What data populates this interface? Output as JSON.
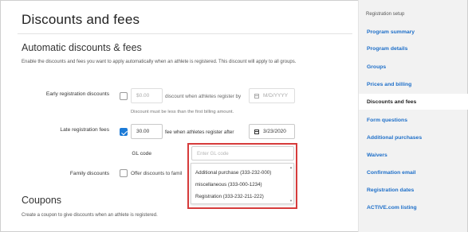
{
  "page": {
    "title": "Discounts and fees"
  },
  "automatic": {
    "title": "Automatic discounts & fees",
    "description": "Enable the discounts and fees you want to apply automatically when an athlete is registered. This discount will apply to all groups."
  },
  "early": {
    "label": "Early registration discounts",
    "checked": false,
    "amount": "$0.00",
    "mid_text": "discount when athletes register by",
    "date_placeholder": "M/D/YYYY",
    "note": "Discount must be less than the first billing amount."
  },
  "late": {
    "label": "Late registration fees",
    "checked": true,
    "amount": "30.00",
    "mid_text": "fee when athletes register after",
    "date": "3/23/2020"
  },
  "gl": {
    "label": "GL code",
    "placeholder": "Enter GL code",
    "options": [
      "Additional purchase (333-232-000)",
      "miscellaneous (333-000-1234)",
      "Registration (333-232-211-222)"
    ]
  },
  "family": {
    "label": "Family discounts",
    "checked": false,
    "text": "Offer discounts to famil"
  },
  "coupons": {
    "title": "Coupons",
    "description": "Create a coupon to give discounts when an athlete is registered."
  },
  "sidebar": {
    "heading": "Registration setup",
    "items": [
      {
        "label": "Program summary",
        "active": false
      },
      {
        "label": "Program details",
        "active": false
      },
      {
        "label": "Groups",
        "active": false
      },
      {
        "label": "Prices and billing",
        "active": false
      },
      {
        "label": "Discounts and fees",
        "active": true
      },
      {
        "label": "Form questions",
        "active": false
      },
      {
        "label": "Additional purchases",
        "active": false
      },
      {
        "label": "Waivers",
        "active": false
      },
      {
        "label": "Confirmation email",
        "active": false
      },
      {
        "label": "Registration dates",
        "active": false
      },
      {
        "label": "ACTIVE.com listing",
        "active": false
      }
    ]
  },
  "colors": {
    "accent": "#1d7bd7",
    "link": "#1e6fc9",
    "highlight": "#d63b3b"
  }
}
